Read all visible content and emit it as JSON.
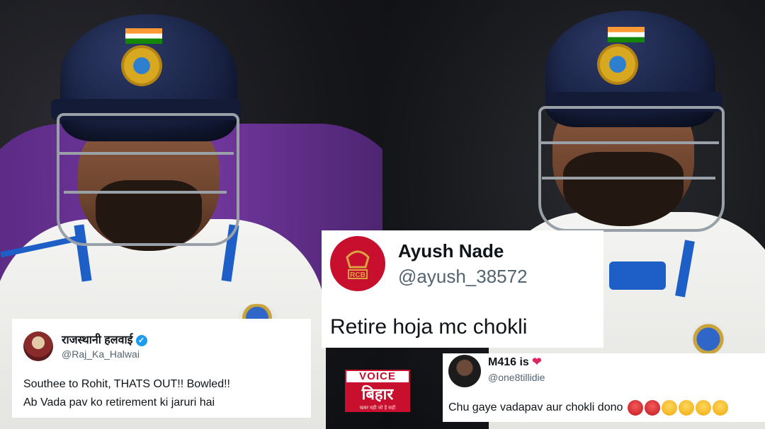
{
  "tweets": [
    {
      "name": "राजस्थानी हलवाई",
      "handle": "@Raj_Ka_Halwai",
      "verified": true,
      "line1": "Southee to Rohit, THATS OUT!! Bowled!!",
      "line2": "Ab Vada pav ko retirement ki jaruri hai",
      "avatar_icon": "person-avatar-icon"
    },
    {
      "name": "Ayush Nade",
      "handle": "@ayush_38572",
      "text": "Retire hoja mc chokli",
      "avatar_icon": "rcb-logo-icon",
      "avatar_color": "#c8102e",
      "avatar_text": "RCB"
    },
    {
      "name": "M416 is",
      "handle": "@one8tillidie",
      "text": "Chu gaye vadapav aur chokli dono",
      "avatar_icon": "person-avatar-icon",
      "name_suffix_icon": "red-heart-icon",
      "emojis": [
        "angry-face-icon",
        "angry-face-icon",
        "crying-laughing-icon",
        "crying-laughing-icon",
        "crying-laughing-icon",
        "crying-laughing-icon"
      ]
    }
  ],
  "watermark": {
    "top": "VOICE",
    "main": "बिहार",
    "tagline": "खबर वही जो है सही",
    "brand_color": "#c8102e"
  }
}
